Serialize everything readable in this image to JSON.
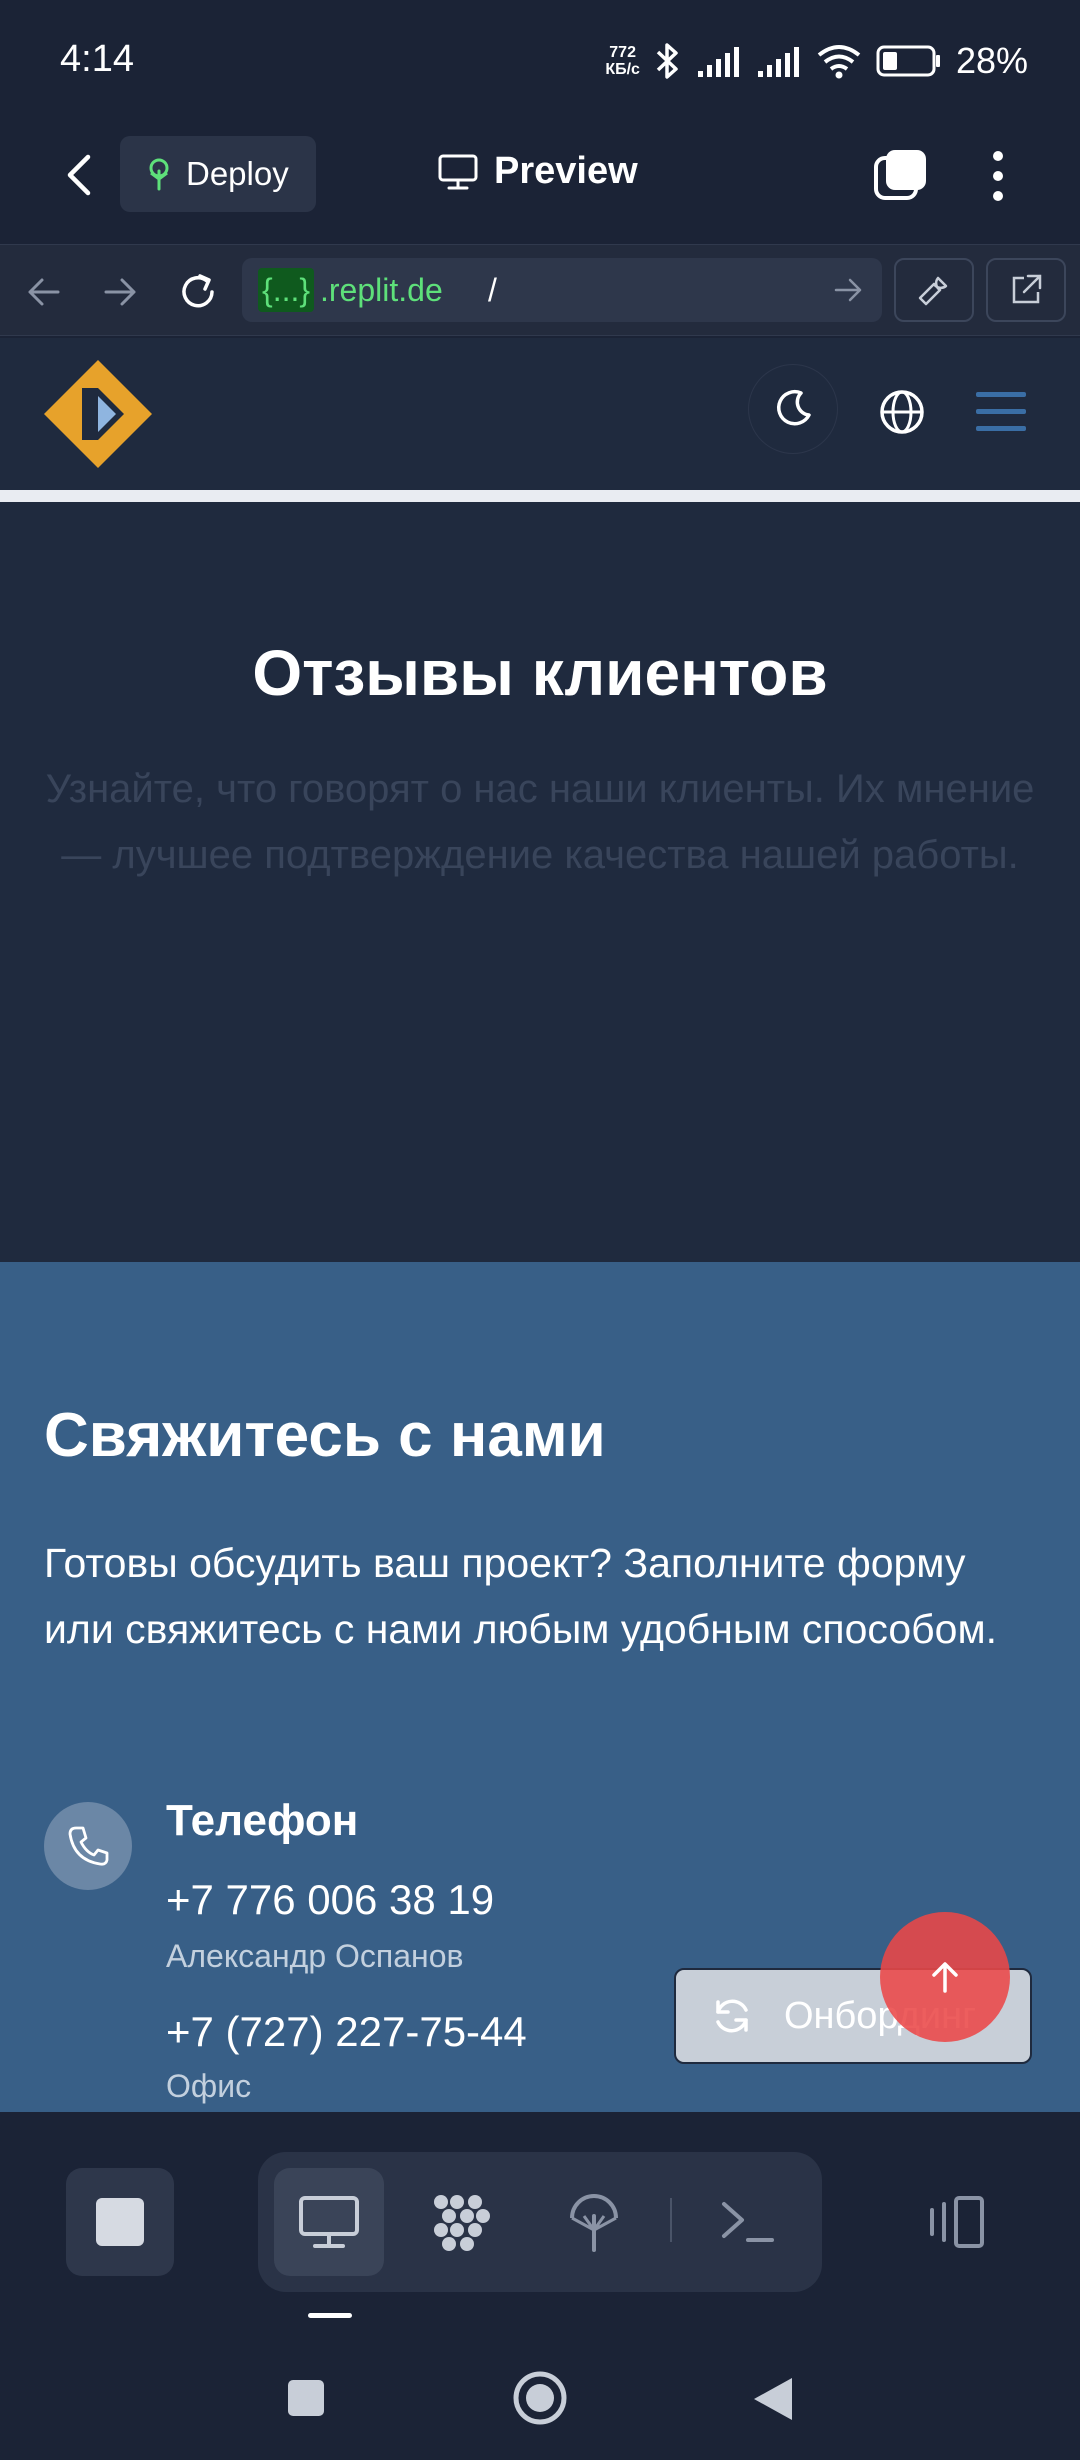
{
  "status_bar": {
    "time": "4:14",
    "net_speed_value": "772",
    "net_speed_unit": "КБ/с",
    "battery": "28%"
  },
  "app_header": {
    "deploy_label": "Deploy",
    "preview_label": "Preview"
  },
  "browser": {
    "url_tag": "{...}",
    "url_domain": ".replit.de",
    "url_path": "/"
  },
  "reviews": {
    "title": "Отзывы клиентов",
    "subtitle": "Узнайте, что говорят о нас наши клиенты. Их мнение — лучшее подтверждение качества нашей работы."
  },
  "contact": {
    "title": "Свяжитесь с нами",
    "text": "Готовы обсудить ваш проект? Заполните форму или свяжитесь с нами любым удобным способом.",
    "phone_label": "Телефон",
    "phone_1": "+7 776 006 38 19",
    "phone_1_name": "Александр Оспанов",
    "phone_2": "+7 (727) 227-75-44",
    "phone_2_name": "Офис"
  },
  "onboarding_label": "Онбординг",
  "colors": {
    "page_bg": "#1b2336",
    "section_dark": "#1f2a3e",
    "contact_bg": "#385f87",
    "url_green": "#5ee07a",
    "logo_orange": "#e7a22b",
    "scroll_top_red": "#eb4848"
  }
}
